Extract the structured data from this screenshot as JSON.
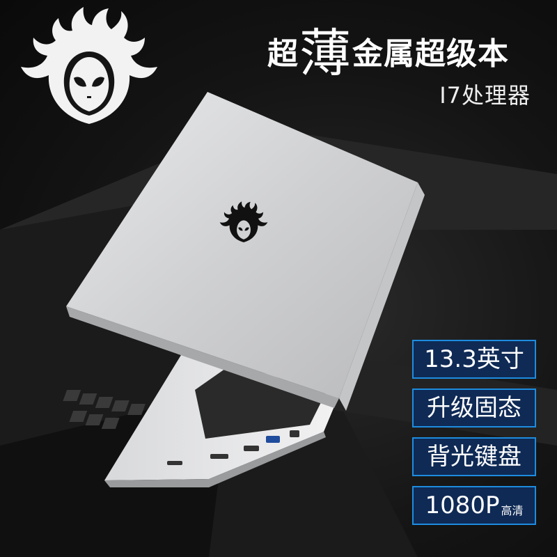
{
  "headline": {
    "part1": "超",
    "part2": "薄",
    "part3": "金属超级本"
  },
  "subheadline": "I7处理器",
  "badges": [
    {
      "main": "13.3英寸",
      "suffix": ""
    },
    {
      "main": "升级固态",
      "suffix": ""
    },
    {
      "main": "背光键盘",
      "suffix": ""
    },
    {
      "main": "1080P",
      "suffix": "高清"
    }
  ],
  "colors": {
    "background": "#141414",
    "badge_border": "#1d8ce0",
    "badge_fill": "#0f2a55",
    "laptop_silver": "#d9dadc"
  },
  "icons": {
    "brand_logo": "flaming-alien-head-icon",
    "lid_logo": "flaming-alien-head-icon"
  }
}
